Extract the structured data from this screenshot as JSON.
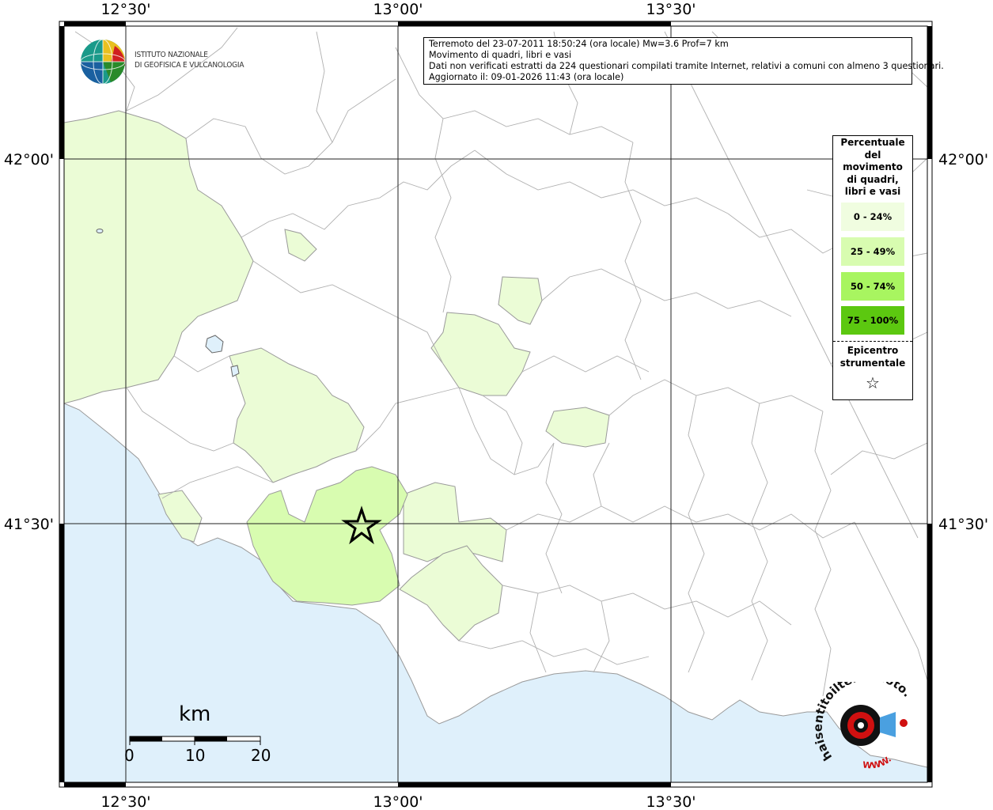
{
  "info": {
    "line1": "Terremoto del 23-07-2011 18:50:24 (ora locale) Mw=3.6 Prof=7 km",
    "line2": "Movimento di quadri, libri e vasi",
    "line3": "Dati non verificati estratti da 224 questionari compilati tramite Internet, relativi a comuni con almeno 3 questionari.",
    "line4": "Aggiornato il: 09-01-2026 11:43 (ora locale)"
  },
  "axes": {
    "lon_labels": [
      "12°30'",
      "13°00'",
      "13°30'"
    ],
    "lat_labels": [
      "42°00'",
      "41°30'"
    ]
  },
  "legend": {
    "title": [
      "Percentuale",
      "del",
      "movimento",
      "di quadri,",
      "libri e vasi"
    ],
    "classes": [
      {
        "label": "0 - 24%",
        "color": "#f0fde0"
      },
      {
        "label": "25 - 49%",
        "color": "#d8fcb0"
      },
      {
        "label": "50 - 74%",
        "color": "#a8f560"
      },
      {
        "label": "75 - 100%",
        "color": "#5cc810"
      }
    ],
    "epicenter": [
      "Epicentro",
      "strumentale"
    ],
    "star_glyph": "☆"
  },
  "logo": {
    "line1": "ISTITUTO NAZIONALE",
    "line2": "DI GEOFISICA E VULCANOLOGIA"
  },
  "scale": {
    "unit": "km",
    "ticks": [
      "0",
      "10",
      "20"
    ]
  },
  "brand": {
    "text": "haisentitoilterremoto.it",
    "www": "WWW."
  },
  "colors": {
    "sea": "#dff0fb",
    "land": "#ffffff",
    "class0": "#f0fde0",
    "class1": "#d8fcb0",
    "border": "#9a9a9a"
  }
}
